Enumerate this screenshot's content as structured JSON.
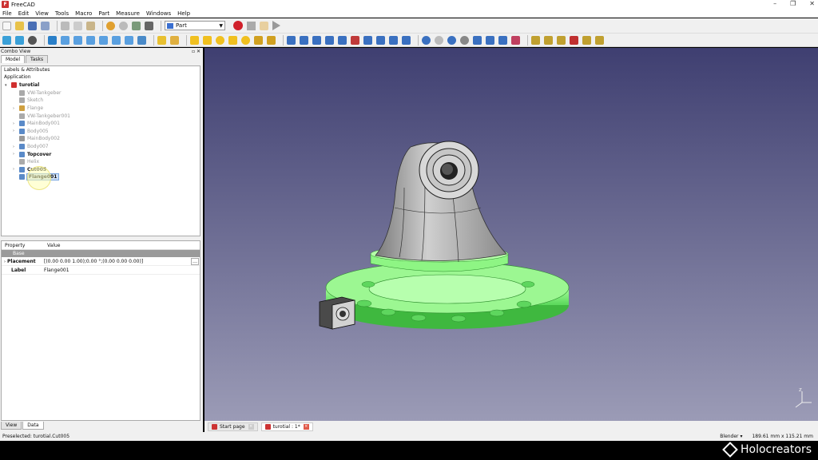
{
  "window": {
    "title": "FreeCAD",
    "controls": [
      "–",
      "❐",
      "✕"
    ]
  },
  "menu": [
    "File",
    "Edit",
    "View",
    "Tools",
    "Macro",
    "Part",
    "Measure",
    "Windows",
    "Help"
  ],
  "workbench": {
    "selected": "Part"
  },
  "combo": {
    "title": "Combo View",
    "tabs": [
      "Model",
      "Tasks"
    ],
    "tree_header": "Labels & Attributes",
    "app_label": "Application",
    "doc": "turotial",
    "items": [
      {
        "label": "VW-Tankgeber",
        "dim": true,
        "arrow": ""
      },
      {
        "label": "Sketch",
        "dim": true,
        "arrow": ""
      },
      {
        "label": "Flange",
        "dim": true,
        "arrow": ">"
      },
      {
        "label": "VW-Tankgeber001",
        "dim": true,
        "arrow": ""
      },
      {
        "label": "MainBody001",
        "dim": true,
        "arrow": ">"
      },
      {
        "label": "Body005",
        "dim": true,
        "arrow": ">"
      },
      {
        "label": "MainBody002",
        "dim": true,
        "arrow": ""
      },
      {
        "label": "Body007",
        "dim": true,
        "arrow": ">"
      },
      {
        "label": "Topcover",
        "dim": false,
        "arrow": ">"
      },
      {
        "label": "Helix",
        "dim": true,
        "arrow": ""
      },
      {
        "label": "Cut005",
        "dim": false,
        "arrow": ">"
      },
      {
        "label": "Flange001",
        "dim": false,
        "arrow": "",
        "selected": true
      }
    ],
    "property_headers": [
      "Property",
      "Value"
    ],
    "group": "Base",
    "properties": [
      {
        "name": "Placement",
        "value": "[(0.00 0.00 1.00);0.00 °;(0.00 0.00 0.00)]"
      },
      {
        "name": "Label",
        "value": "Flange001"
      }
    ],
    "bottom_tabs": [
      "View",
      "Data"
    ]
  },
  "doc_tabs": [
    "Start page",
    "turotial : 1*"
  ],
  "status": {
    "preselect": "Preselected: turotial.Cut005",
    "nav": "Blender",
    "dimensions": "189.61 mm x 115.21 mm"
  },
  "brand": "Holocreators",
  "colors": {
    "accent_green": "#7cf27c",
    "part_gray": "#b9b9b9",
    "viewport_top": "#3f3f71",
    "viewport_bottom": "#9b9bb6"
  }
}
